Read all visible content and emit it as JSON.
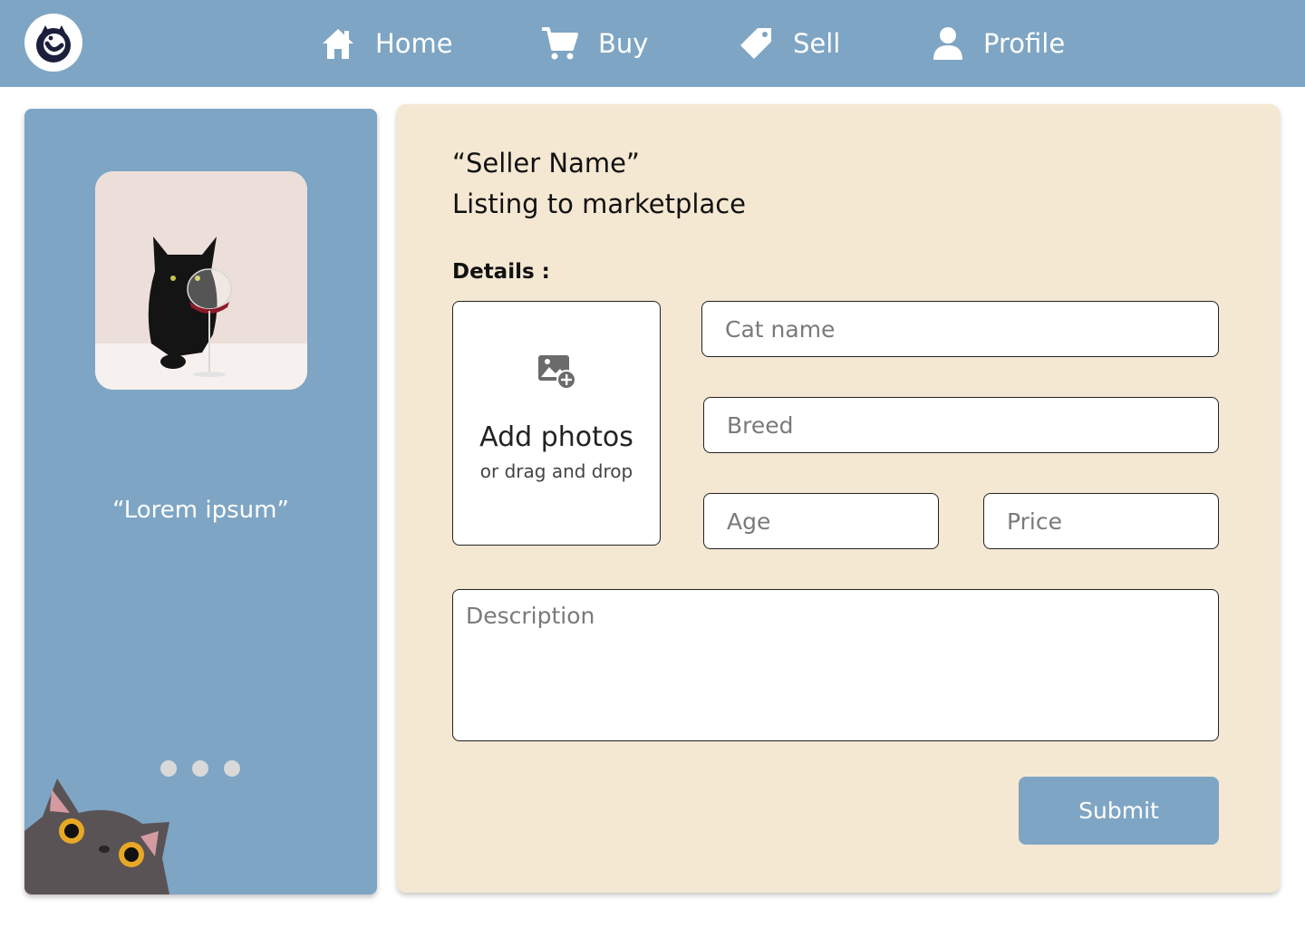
{
  "nav": {
    "items": [
      {
        "label": "Home",
        "icon": "home-icon"
      },
      {
        "label": "Buy",
        "icon": "cart-icon"
      },
      {
        "label": "Sell",
        "icon": "tag-icon"
      },
      {
        "label": "Profile",
        "icon": "user-icon"
      }
    ],
    "logo_icon": "cat-logo-icon"
  },
  "sidebar": {
    "quote": "“Lorem ipsum”",
    "carousel_dots": 3
  },
  "form": {
    "seller_name": "“Seller Name”",
    "title": "Listing to marketplace",
    "details_label": "Details :",
    "photos": {
      "main": "Add photos",
      "sub": "or drag and drop",
      "icon": "add-image-icon"
    },
    "fields": {
      "cat_name": {
        "placeholder": "Cat name",
        "value": ""
      },
      "breed": {
        "placeholder": "Breed",
        "value": ""
      },
      "age": {
        "placeholder": "Age",
        "value": ""
      },
      "price": {
        "placeholder": "Price",
        "value": ""
      },
      "description": {
        "placeholder": "Description",
        "value": ""
      }
    },
    "submit_label": "Submit"
  },
  "colors": {
    "primary_blue": "#7ea5c4",
    "panel_beige": "#f5e8d3",
    "dot_gray": "#d9d9d9"
  }
}
